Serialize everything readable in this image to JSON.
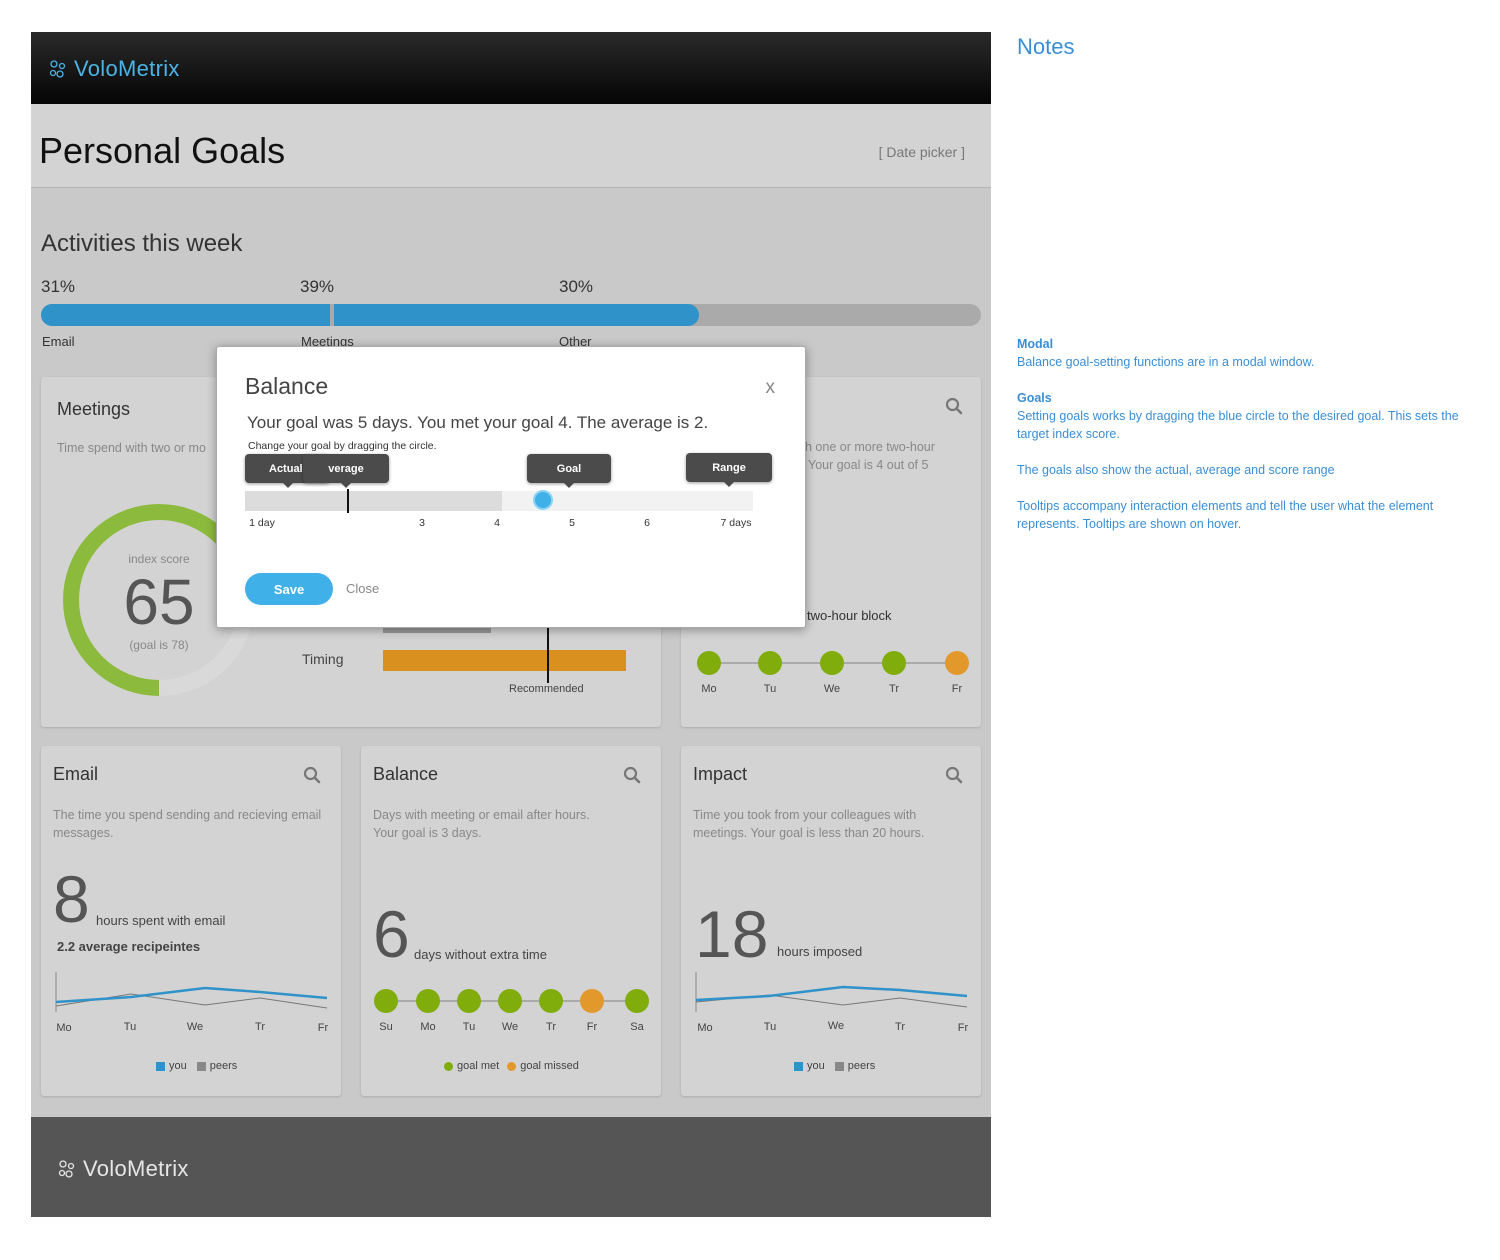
{
  "header": {
    "brand": "VoloMetrix"
  },
  "page": {
    "title": "Personal Goals",
    "date_picker": "[ Date picker ]"
  },
  "activities": {
    "title": "Activities this week",
    "segments": [
      {
        "label": "Email",
        "percent": "31%",
        "value": 31
      },
      {
        "label": "Meetings",
        "percent": "39%",
        "value": 39
      },
      {
        "label": "Other",
        "percent": "30%",
        "value": 30
      }
    ]
  },
  "meetings_card": {
    "title": "Meetings",
    "desc": "Time spend with two or mo",
    "index_label": "index score",
    "score": "65",
    "goal_text": "(goal is 78)",
    "score_fraction": 0.65,
    "timing_label": "Timing",
    "recommended_label": "Recommended"
  },
  "blocks_card": {
    "desc_line1": "h one or more two-hour",
    "desc_line2": "Your goal is 4 out of 5",
    "block_label": "two-hour block",
    "days": [
      "Mo",
      "Tu",
      "We",
      "Tr",
      "Fr"
    ],
    "status": [
      "met",
      "met",
      "met",
      "met",
      "missed"
    ]
  },
  "email_card": {
    "title": "Email",
    "desc": "The time you spend sending and recieving email messages.",
    "number": "8",
    "number_label": "hours spent with email",
    "sub": "2.2 average recipeintes",
    "days": [
      "Mo",
      "Tu",
      "We",
      "Tr",
      "Fr"
    ],
    "legend_you": "you",
    "legend_peers": "peers"
  },
  "balance_card": {
    "title": "Balance",
    "desc": "Days with meeting or email after hours. Your goal is 3 days.",
    "number": "6",
    "number_label": "days without extra time",
    "days": [
      "Su",
      "Mo",
      "Tu",
      "We",
      "Tr",
      "Fr",
      "Sa"
    ],
    "status": [
      "met",
      "met",
      "met",
      "met",
      "met",
      "missed",
      "met"
    ],
    "legend_met": "goal met",
    "legend_missed": "goal missed"
  },
  "impact_card": {
    "title": "Impact",
    "desc": "Time you took from your colleagues with meetings. Your goal is less than 20 hours.",
    "number": "18",
    "number_label": "hours imposed",
    "days": [
      "Mo",
      "Tu",
      "We",
      "Tr",
      "Fr"
    ],
    "legend_you": "you",
    "legend_peers": "peers"
  },
  "modal": {
    "title": "Balance",
    "close_x": "x",
    "summary": "Your goal was 5 days. You met your goal 4. The average is 2.",
    "instruction": "Change your goal by dragging the circle.",
    "tooltips": {
      "actual": "Actual",
      "average": "verage",
      "goal": "Goal",
      "range": "Range"
    },
    "ticks": [
      "1 day",
      "3",
      "4",
      "5",
      "6",
      "7 days"
    ],
    "goal_value": 5,
    "actual_value": 4,
    "average_value": 2,
    "save_label": "Save",
    "close_label": "Close"
  },
  "footer": {
    "brand": "VoloMetrix"
  },
  "notes": {
    "title": "Notes",
    "modal_heading": "Modal",
    "modal_text": "Balance goal-setting functions are in a modal window.",
    "goals_heading": "Goals",
    "goals_text": "Setting goals works by dragging the blue circle to the desired goal. This sets the target index score.",
    "goals_text2": "The goals also show the actual, average and score range",
    "tooltips_text": "Tooltips accompany interaction elements and tell the user what the element represents. Tooltips are shown on hover."
  },
  "colors": {
    "brand_blue": "#4bb3e6",
    "bar_blue": "#2f93c9",
    "goal_met": "#80ad0b",
    "goal_missed": "#e3982b",
    "score_green": "#8cba3c",
    "timing_orange": "#d9901f",
    "notes_blue": "#3a8ed6"
  },
  "icons": [
    "logo-mark-icon",
    "search-icon",
    "close-icon"
  ]
}
